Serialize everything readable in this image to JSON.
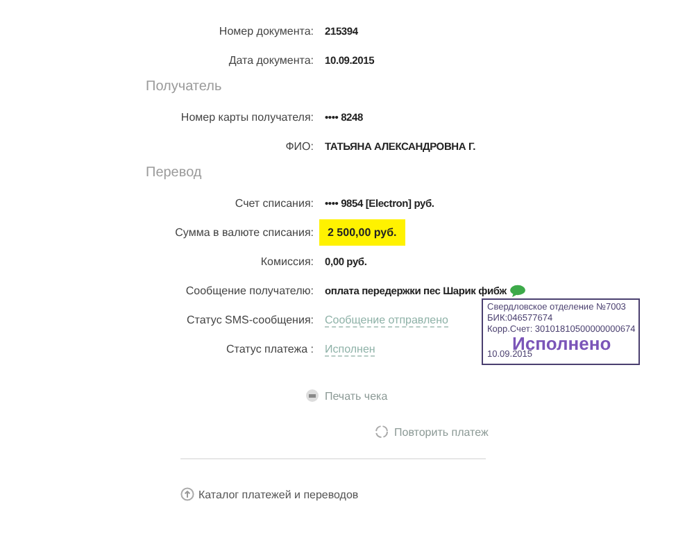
{
  "sections": [
    {
      "rows": [
        {
          "label": "Номер документа:",
          "value": "215394",
          "kind": "plain"
        },
        {
          "label": "Дата документа:",
          "value": "10.09.2015",
          "kind": "plain"
        }
      ]
    },
    {
      "title": "Получатель",
      "rows": [
        {
          "label": "Номер карты получателя:",
          "value": "•••• 8248",
          "kind": "plain"
        },
        {
          "label": "ФИО:",
          "value": "ТАТЬЯНА АЛЕКСАНДРОВНА Г.",
          "kind": "plain"
        }
      ]
    },
    {
      "title": "Перевод",
      "rows": [
        {
          "label": "Счет списания:",
          "value": "•••• 9854  [Electron]  руб.",
          "kind": "plain"
        },
        {
          "label": "Сумма в валюте списания:",
          "value": "2 500,00  руб.",
          "kind": "highlight"
        },
        {
          "label": "Комиссия:",
          "value": "0,00 руб.",
          "kind": "plain"
        },
        {
          "label": "Сообщение получателю:",
          "value": "оплата передержки пес Шарик фибж",
          "kind": "message"
        },
        {
          "label": "Статус SMS-сообщения:",
          "value": "Сообщение отправлено",
          "kind": "link"
        },
        {
          "label": "Статус платежа :",
          "value": "Исполнен",
          "kind": "link"
        }
      ]
    }
  ],
  "stamp": {
    "lines": [
      "Свердловское отделение №7003",
      "БИК:046577674",
      "Корр.Счет: 30101810500000000674"
    ],
    "status": "Исполнено",
    "date": "10.09.2015"
  },
  "actions": [
    {
      "label": "Печать чека",
      "kind": "print"
    },
    {
      "label": "Повторить платеж",
      "kind": "repeat"
    }
  ],
  "footer_link": "Каталог платежей и переводов"
}
